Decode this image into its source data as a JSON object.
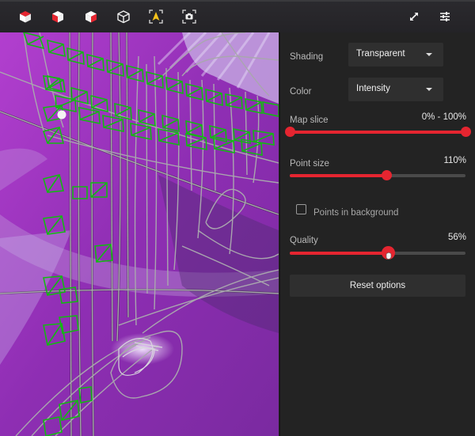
{
  "toolbar": {
    "left_buttons": [
      {
        "icon": "cube-top-view-icon",
        "tooltip": ""
      },
      {
        "icon": "cube-left-view-icon",
        "tooltip": ""
      },
      {
        "icon": "cube-right-view-icon",
        "tooltip": ""
      },
      {
        "icon": "cube-perspective-icon",
        "tooltip": ""
      },
      {
        "icon": "navigation-focus-icon",
        "tooltip": ""
      },
      {
        "icon": "screenshot-camera-icon",
        "tooltip": ""
      }
    ],
    "right_buttons": [
      {
        "icon": "fullscreen-expand-icon"
      },
      {
        "icon": "settings-sliders-icon"
      }
    ]
  },
  "settings": {
    "shading": {
      "label": "Shading",
      "value": "Transparent"
    },
    "color": {
      "label": "Color",
      "value": "Intensity"
    },
    "map_slice": {
      "label": "Map slice",
      "value_text": "0% - 100%",
      "min": 0,
      "max": 100
    },
    "point_size": {
      "label": "Point size",
      "value_text": "110%",
      "fraction": 0.55
    },
    "points_in_background": {
      "label": "Points in background",
      "checked": false
    },
    "quality": {
      "label": "Quality",
      "value_text": "56%",
      "fraction": 0.56
    },
    "reset_label": "Reset options"
  },
  "colors": {
    "accent": "#e52530",
    "panel_bg": "#232323",
    "trajectory_green": "#1fd11f",
    "path_gray": "#9a9a9a",
    "map_magenta": "#a23bc0"
  }
}
